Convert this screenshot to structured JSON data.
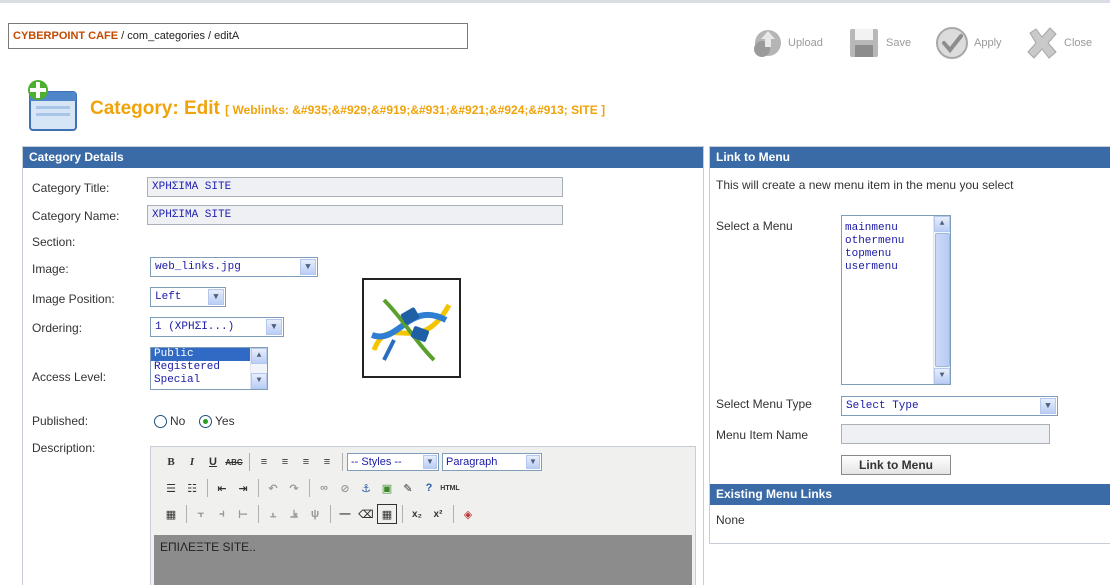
{
  "breadcrumb": {
    "site": "CYBERPOINT CAFE",
    "path": " / com_categories / editA"
  },
  "toolbar": {
    "upload": "Upload",
    "save": "Save",
    "apply": "Apply",
    "close": "Close"
  },
  "header": {
    "title": "Category: Edit",
    "subtitle": "[ Weblinks: &#935;&#929;&#919;&#931;&#921;&#924;&#913; SITE ]"
  },
  "details": {
    "heading": "Category Details",
    "labels": {
      "title": "Category Title:",
      "name": "Category Name:",
      "section": "Section:",
      "image": "Image:",
      "image_position": "Image Position:",
      "ordering": "Ordering:",
      "access": "Access Level:",
      "published": "Published:",
      "description": "Description:"
    },
    "category_title": "ΧΡΗΣΙΜΑ SITE",
    "category_name": "ΧΡΗΣΙΜΑ SITE",
    "image_value": "web_links.jpg",
    "image_position_value": "Left",
    "ordering_value": "1 (ΧΡΗΣΙ...)",
    "access_levels": [
      "Public",
      "Registered",
      "Special"
    ],
    "access_selected": "Public",
    "published": {
      "no": "No",
      "yes": "Yes",
      "value": "Yes"
    }
  },
  "editor": {
    "styles_select": "-- Styles --",
    "format_select": "Paragraph",
    "content": "ΕΠΙΛΕΞΤΕ SITE.."
  },
  "link_to_menu": {
    "heading": "Link to Menu",
    "description": "This will create a new menu item in the menu you select",
    "select_menu_label": "Select a Menu",
    "menus": [
      "mainmenu",
      "othermenu",
      "topmenu",
      "usermenu"
    ],
    "select_menu_type_label": "Select Menu Type",
    "menu_type_value": "Select Type",
    "menu_item_name_label": "Menu Item Name",
    "menu_item_name_value": "",
    "button": "Link to Menu"
  },
  "existing_links": {
    "heading": "Existing Menu Links",
    "value": "None"
  },
  "colors": {
    "header_blue": "#3b6ba6",
    "title_orange": "#f0a30a",
    "breadcrumb_site": "#c34a00"
  }
}
